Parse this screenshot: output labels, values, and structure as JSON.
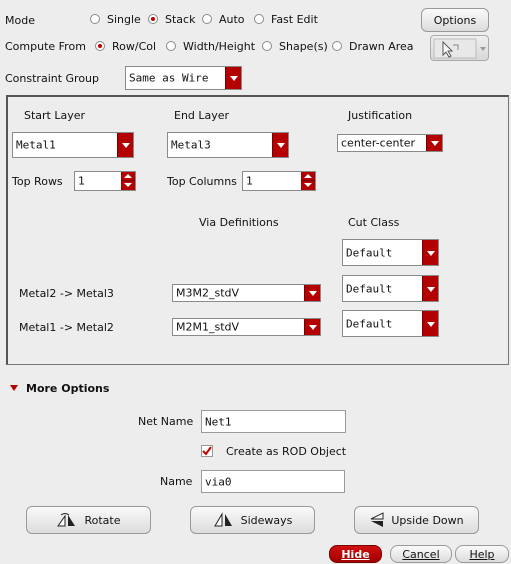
{
  "top": {
    "mode_label": "Mode",
    "mode_options": [
      "Single",
      "Stack",
      "Auto",
      "Fast Edit"
    ],
    "mode_selected": "Stack",
    "options_button": "Options",
    "compute_label": "Compute From",
    "compute_options": [
      "Row/Col",
      "Width/Height",
      "Shape(s)",
      "Drawn Area"
    ],
    "compute_selected": "Row/Col",
    "constraint_label": "Constraint Group",
    "constraint_value": "Same as Wire"
  },
  "stack": {
    "start_layer_label": "Start Layer",
    "start_layer_value": "Metal1",
    "end_layer_label": "End Layer",
    "end_layer_value": "Metal3",
    "justification_label": "Justification",
    "justification_value": "center-center",
    "top_rows_label": "Top Rows",
    "top_rows_value": "1",
    "top_columns_label": "Top Columns",
    "top_columns_value": "1",
    "via_defs_header": "Via Definitions",
    "cut_class_header": "Cut Class",
    "rows": [
      {
        "layer_pair": "",
        "via_def": "",
        "cut_class": "Default"
      },
      {
        "layer_pair": "Metal2 -> Metal3",
        "via_def": "M3M2_stdV",
        "cut_class": "Default"
      },
      {
        "layer_pair": "Metal1 -> Metal2",
        "via_def": "M2M1_stdV",
        "cut_class": "Default"
      }
    ]
  },
  "more": {
    "title": "More Options",
    "net_name_label": "Net Name",
    "net_name_value": "Net1",
    "rod_checkbox_label": "Create as ROD Object",
    "rod_checked": true,
    "name_label": "Name",
    "name_value": "via0",
    "rotate_button": "Rotate",
    "sideways_button": "Sideways",
    "upside_down_button": "Upside Down"
  },
  "footer": {
    "hide": "Hide",
    "cancel": "Cancel",
    "help": "Help"
  },
  "colors": {
    "accent": "#b30000"
  }
}
